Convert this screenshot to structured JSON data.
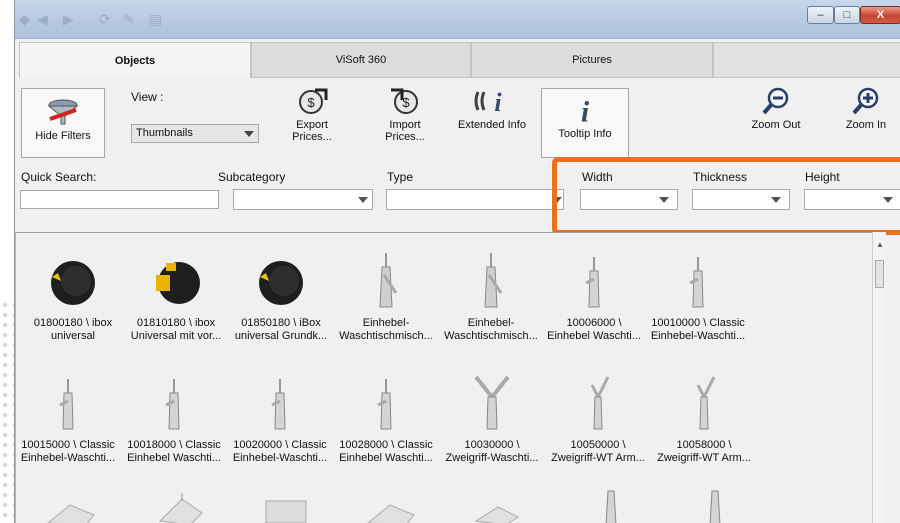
{
  "titlebar": {
    "icons": [
      "app-icon",
      "back-icon",
      "forward-icon",
      "refresh-icon",
      "tools-icon",
      "folder-icon"
    ],
    "minimize": "–",
    "maximize": "□",
    "close": "X"
  },
  "tabs": [
    {
      "label": "Objects"
    },
    {
      "label": "ViSoft 360"
    },
    {
      "label": "Pictures"
    }
  ],
  "toolbar": {
    "hide_filters": "Hide Filters",
    "view_label": "View :",
    "view_value": "Thumbnails",
    "export_l1": "Export",
    "export_l2": "Prices...",
    "import_l1": "Import",
    "import_l2": "Prices...",
    "extended_info": "Extended Info",
    "tooltip_info": "Tooltip Info",
    "zoom_out": "Zoom Out",
    "zoom_in": "Zoom In"
  },
  "filters": {
    "quick_search": "Quick Search:",
    "subcategory": "Subcategory",
    "type": "Type",
    "width": "Width",
    "thickness": "Thickness",
    "height": "Height"
  },
  "items": [
    {
      "l1": "01800180 \\ ibox",
      "l2": "universal",
      "kind": "ibox"
    },
    {
      "l1": "01810180 \\ ibox",
      "l2": "Universal mit vor...",
      "kind": "ibox-gold"
    },
    {
      "l1": "01850180 \\ iBox",
      "l2": "universal Grundk...",
      "kind": "ibox"
    },
    {
      "l1": "Einhebel-",
      "l2": "Waschtischmisch...",
      "kind": "faucet"
    },
    {
      "l1": "Einhebel-",
      "l2": "Waschtischmisch...",
      "kind": "faucet"
    },
    {
      "l1": "10006000 \\",
      "l2": "Einhebel Waschti...",
      "kind": "faucet"
    },
    {
      "l1": "10010000 \\ Classic",
      "l2": "Einhebel-Waschti...",
      "kind": "faucet"
    },
    {
      "l1": "10015000 \\ Classic",
      "l2": "Einhebel-Waschti...",
      "kind": "faucet"
    },
    {
      "l1": "10018000 \\ Classic",
      "l2": "Einhebel Waschti...",
      "kind": "faucet"
    },
    {
      "l1": "10020000 \\ Classic",
      "l2": "Einhebel-Waschti...",
      "kind": "faucet"
    },
    {
      "l1": "10028000 \\ Classic",
      "l2": "Einhebel Waschti...",
      "kind": "faucet"
    },
    {
      "l1": "10030000 \\",
      "l2": "Zweigriff-Waschti...",
      "kind": "twohandle"
    },
    {
      "l1": "10050000 \\",
      "l2": "Zweigriff-WT Arm...",
      "kind": "twohandle"
    },
    {
      "l1": "10058000 \\",
      "l2": "Zweigriff-WT Arm...",
      "kind": "twohandle"
    }
  ]
}
